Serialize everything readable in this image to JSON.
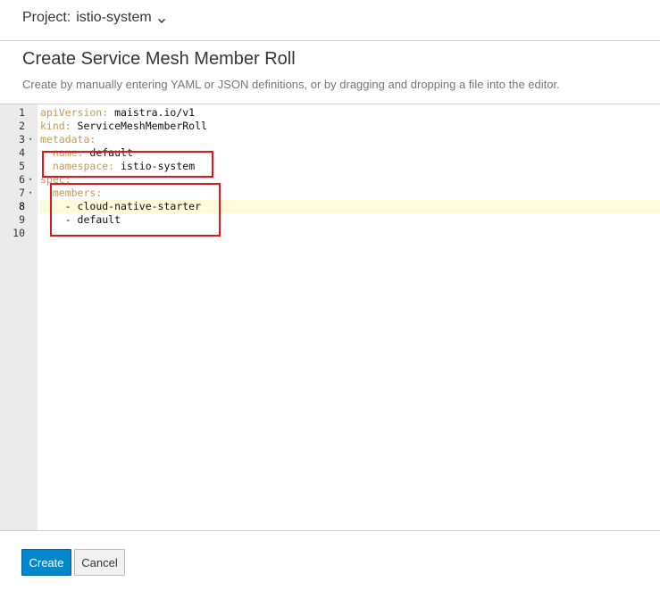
{
  "project": {
    "label": "Project:",
    "name": "istio-system",
    "chevron_icon": "chevron-down-icon"
  },
  "page": {
    "title": "Create Service Mesh Member Roll",
    "help": "Create by manually entering YAML or JSON definitions, or by dragging and dropping a file into the editor."
  },
  "editor": {
    "lines": [
      {
        "num": "1",
        "key": "apiVersion: ",
        "value": "maistra.io/v1",
        "indent": "",
        "fold": false
      },
      {
        "num": "2",
        "key": "kind: ",
        "value": "ServiceMeshMemberRoll",
        "indent": "",
        "fold": false
      },
      {
        "num": "3",
        "key": "metadata:",
        "value": "",
        "indent": "",
        "fold": true
      },
      {
        "num": "4",
        "key": "name: ",
        "value": "default",
        "indent": "  ",
        "fold": false
      },
      {
        "num": "5",
        "key": "namespace: ",
        "value": "istio-system",
        "indent": "  ",
        "fold": false
      },
      {
        "num": "6",
        "key": "spec:",
        "value": "",
        "indent": "",
        "fold": true
      },
      {
        "num": "7",
        "key": "members:",
        "value": "",
        "indent": "  ",
        "fold": true
      },
      {
        "num": "8",
        "key": "",
        "value": "- cloud-native-starter",
        "indent": "    ",
        "fold": false
      },
      {
        "num": "9",
        "key": "",
        "value": "- default",
        "indent": "    ",
        "fold": false
      },
      {
        "num": "10",
        "key": "",
        "value": "",
        "indent": "",
        "fold": false
      }
    ],
    "active_line": "8"
  },
  "actions": {
    "create_label": "Create",
    "cancel_label": "Cancel"
  }
}
